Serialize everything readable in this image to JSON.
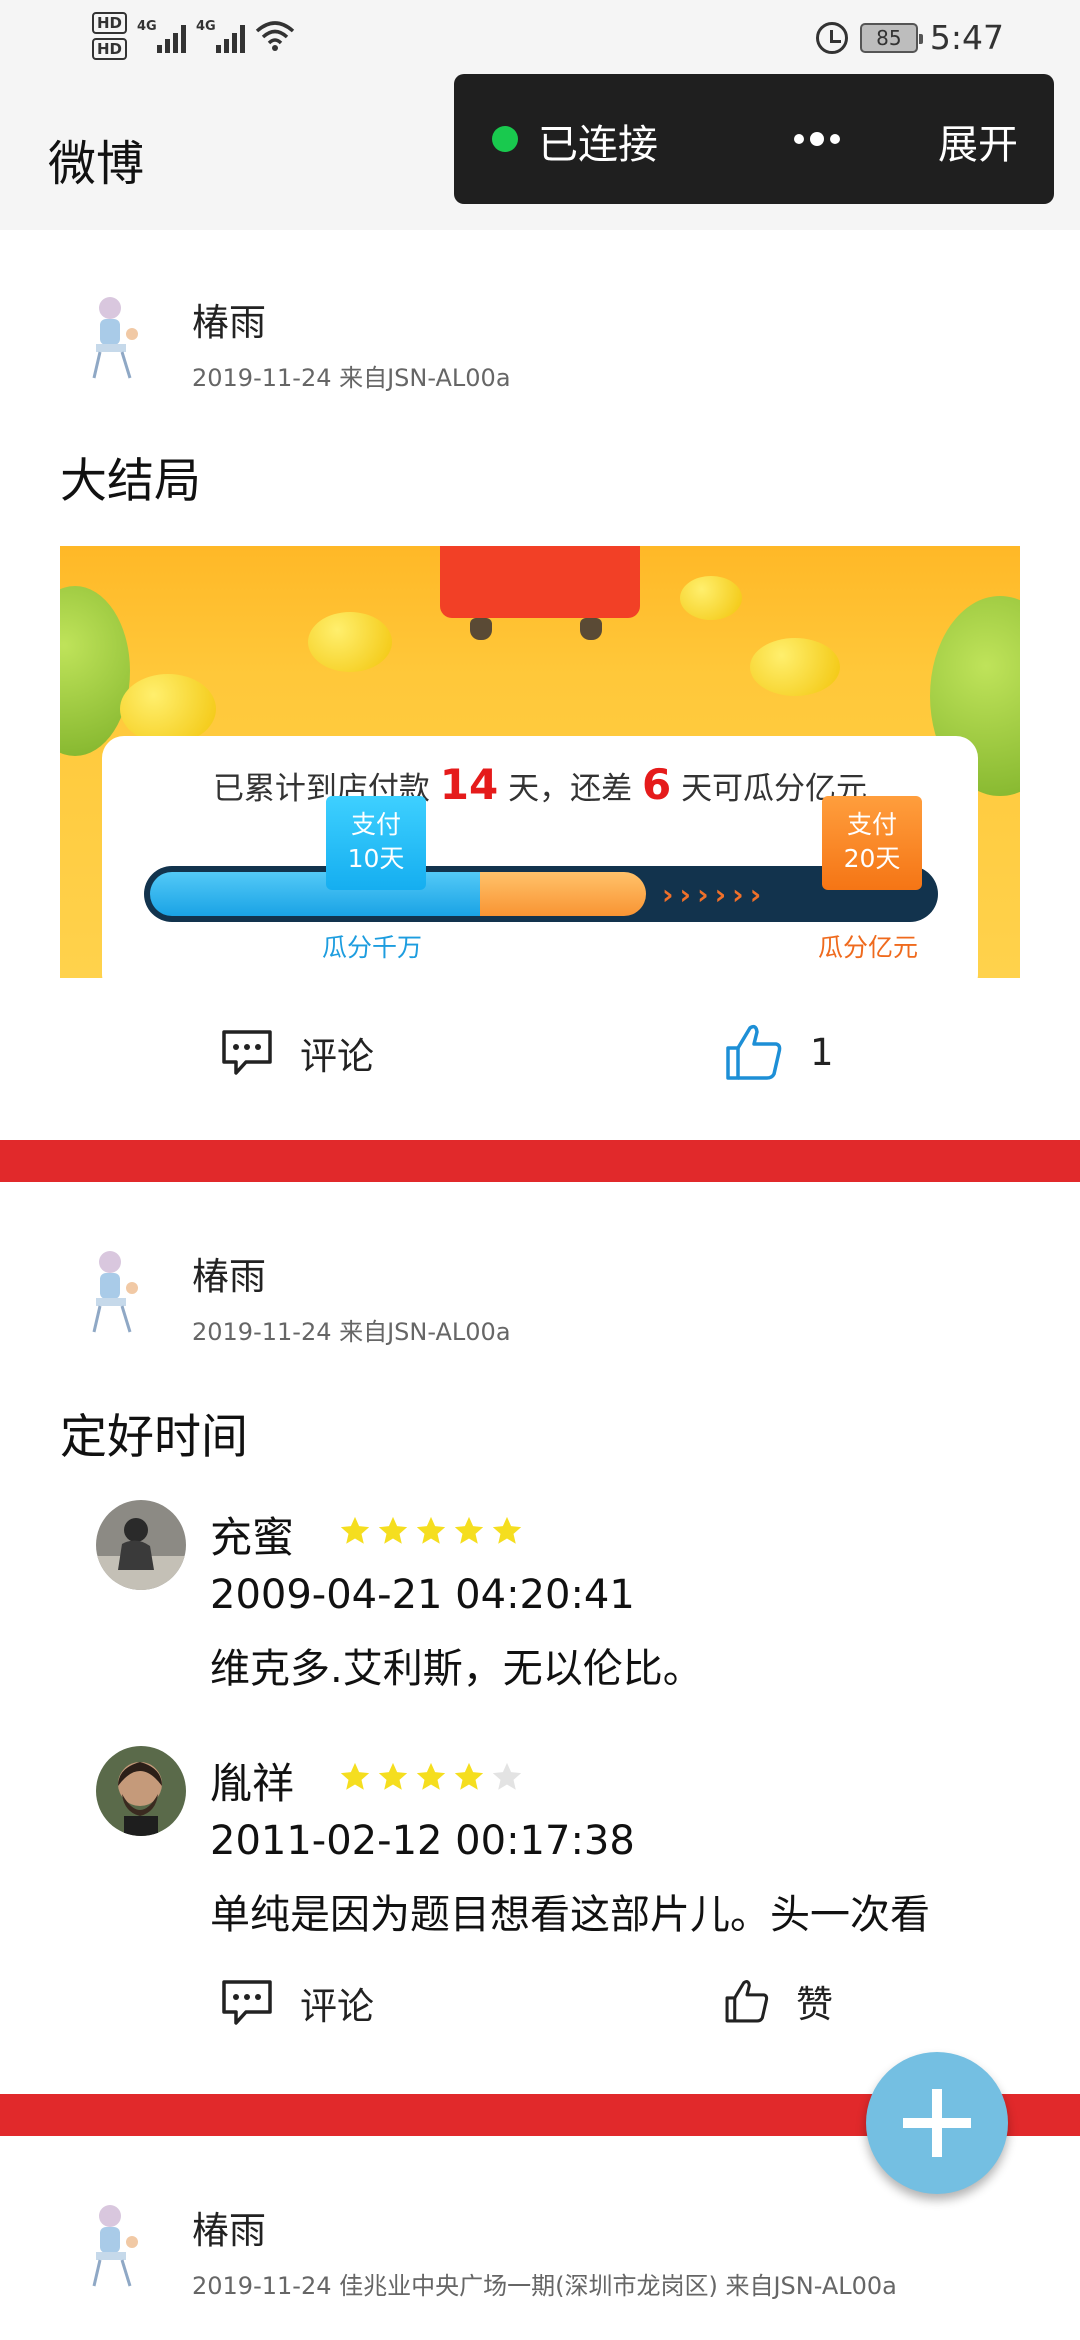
{
  "status_bar": {
    "hd1": "HD",
    "hd2": "HD",
    "signal1_label": "4G",
    "signal2_label": "4G",
    "battery": "85",
    "time": "5:47"
  },
  "app_bar": {
    "title": "微博",
    "connection_status": "已连接",
    "expand_label": "展开"
  },
  "posts": [
    {
      "user": "椿雨",
      "meta": "2019-11-24  来自JSN-AL00a",
      "title": "大结局",
      "banner": {
        "line_prefix": "已累计到店付款",
        "paid_days": "14",
        "mid": "天，还差",
        "remaining_days": "6",
        "suffix": "天可瓜分亿元",
        "tag1_line1": "支付",
        "tag1_line2": "10天",
        "tag1_reward": "瓜分千万",
        "tag2_line1": "支付",
        "tag2_line2": "20天",
        "tag2_reward": "瓜分亿元",
        "chevrons": "››››››",
        "progress_fraction": 0.7
      },
      "comment_label": "评论",
      "like_count": "1"
    },
    {
      "user": "椿雨",
      "meta": "2019-11-24  来自JSN-AL00a",
      "title": "定好时间",
      "comments": [
        {
          "name": "充蜜",
          "rating": 5,
          "date": "2009-04-21 04:20:41",
          "text": "维克多.艾利斯，无以伦比。"
        },
        {
          "name": "胤祥",
          "rating": 4,
          "date": "2011-02-12 00:17:38",
          "text": "单纯是因为题目想看这部片儿。头一次看"
        }
      ],
      "comment_label": "评论",
      "like_label": "赞"
    },
    {
      "user": "椿雨",
      "meta": "2019-11-24  佳兆业中央广场一期(深圳市龙岗区)  来自JSN-AL00a"
    }
  ],
  "colors": {
    "divider": "#e1292b",
    "fab": "#74bfe2",
    "star": "#f5de1f",
    "like_active": "#1d8fd6"
  },
  "icons": [
    "hd-icon",
    "signal-icon",
    "wifi-icon",
    "alarm-icon",
    "battery-icon",
    "more-icon",
    "comment-icon",
    "thumbs-up-icon",
    "star-icon",
    "plus-icon"
  ]
}
